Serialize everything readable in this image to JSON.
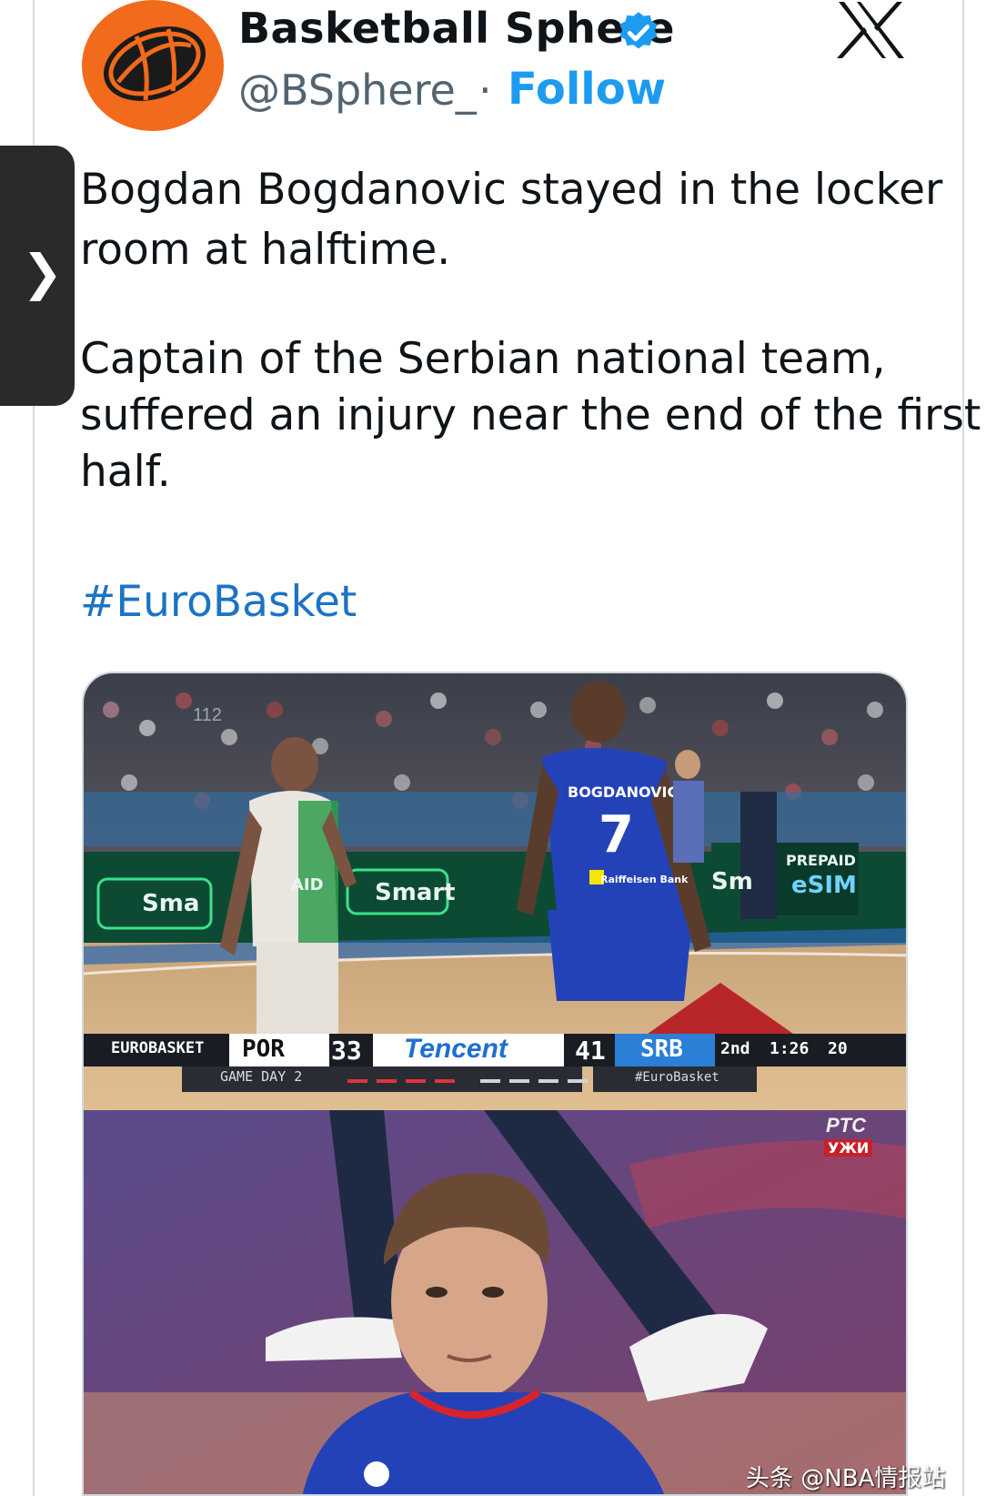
{
  "account": {
    "display_name": "Basketball Sphere",
    "handle": "@BSphere_",
    "separator": "·",
    "follow_label": "Follow"
  },
  "tweet": {
    "line1": "Bogdan Bogdanovic stayed in the locker",
    "line2": "room at halftime.",
    "line3": "Captain of the Serbian national team,",
    "line4": "suffered an injury near the end of the first",
    "line5": "half.",
    "hashtag": "#EuroBasket"
  },
  "media": {
    "jersey_name": "BOGDANOVIC",
    "jersey_number": "7",
    "jersey_sponsor": "Raiffeisen Bank",
    "ad_smart_1": "Sma",
    "ad_smart_2": "Smart",
    "ad_paid": "AID",
    "ad_sm": "Sm",
    "ad_prepaid": "PREPAID",
    "ad_esim": "eSIM",
    "section_sign": "112",
    "scoreboard": {
      "league": "EUROBASKET",
      "team_left": "POR",
      "score_left": "33",
      "sponsor": "Tencent",
      "score_right": "41",
      "team_right": "SRB",
      "period": "2nd",
      "clock": "1:26",
      "shot_clock": "20",
      "sub_left": "GAME DAY 2",
      "sub_right": "#EuroBasket"
    },
    "broadcaster_1": "PTC",
    "broadcaster_2": "УЖИ"
  },
  "watermark": "头条 @NBA情报站",
  "colors": {
    "follow_blue": "#1d9bf0",
    "hashtag_blue": "#1d73c4",
    "avatar_orange": "#f26a1b",
    "serbia_blue": "#2442b8"
  },
  "icons": {
    "verified": "verified-badge-icon",
    "platform": "x-logo-icon",
    "expand": "chevron-right-icon"
  }
}
